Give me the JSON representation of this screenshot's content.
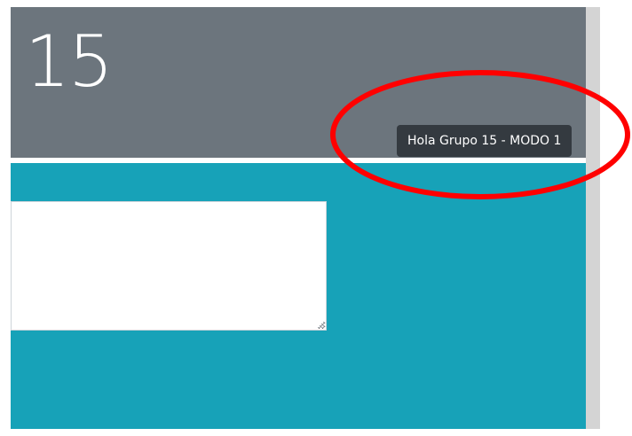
{
  "header": {
    "number": "15"
  },
  "tooltip": {
    "text": "Hola Grupo 15 - MODO 1"
  },
  "textarea": {
    "value": "",
    "placeholder": ""
  },
  "colors": {
    "header_bg": "#6c757d",
    "panel_bg": "#17a2b8",
    "tooltip_bg": "#343a40",
    "annotation": "#ff0000"
  }
}
